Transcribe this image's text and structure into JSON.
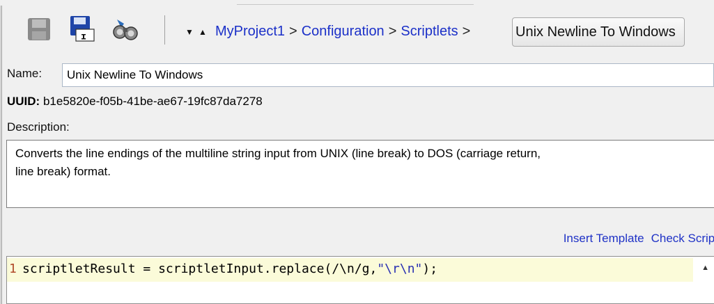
{
  "toolbar": {
    "breadcrumb": {
      "items": [
        "MyProject1",
        "Configuration",
        "Scriptlets"
      ],
      "separator": ">",
      "current": "Unix Newline To Windows"
    }
  },
  "form": {
    "name_label": "Name:",
    "name_value": "Unix Newline To Windows",
    "uuid_label": "UUID:",
    "uuid_value": "b1e5820e-f05b-41be-ae67-19fc87da7278",
    "description_label": "Description:",
    "description_line1": "Converts the line endings of the multiline string input from UNIX (line break) to DOS (carriage return,",
    "description_line2": "line break) format."
  },
  "actions": {
    "insert_template": "Insert Template",
    "check_script": "Check Script"
  },
  "editor": {
    "line_number": "1",
    "code_part1": "scriptletResult = scriptletInput.replace(/\\n/g,",
    "code_string": "\"\\r\\n\"",
    "code_part3": ");"
  }
}
